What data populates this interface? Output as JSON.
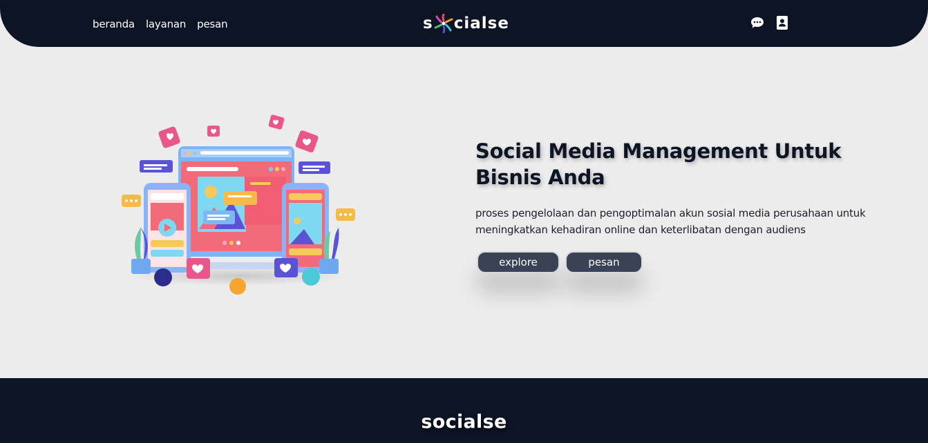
{
  "nav": {
    "links": [
      "beranda",
      "layanan",
      "pesan"
    ],
    "brand_prefix": "s",
    "brand_suffix": "cialse",
    "icons": [
      "chat-icon",
      "contact-icon"
    ]
  },
  "hero": {
    "title": "Social Media Management Untuk Bisnis Anda",
    "description": "proses pengelolaan dan pengoptimalan akun sosial media perusahaan untuk meningkatkan kehadiran online dan keterlibatan dengan audiens",
    "buttons": {
      "explore": "explore",
      "pesan": "pesan"
    }
  },
  "footer": {
    "brand": "socialse"
  },
  "colors": {
    "dark": "#0d1424",
    "background": "#ececec",
    "button": "#3a4256"
  }
}
